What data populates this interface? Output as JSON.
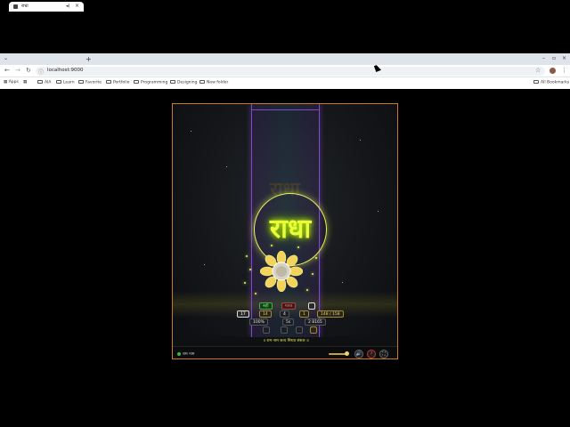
{
  "browser": {
    "tab_title": "राधा",
    "tab_close": "×",
    "new_tab": "+",
    "url": "localhost:9000",
    "back": "←",
    "forward": "→",
    "reload": "↻",
    "star": "☆",
    "menu": "⋮",
    "bookmarks": [
      "Apps",
      "AIA",
      "Learn",
      "Favorite",
      "Portfolio",
      "Programming",
      "Designing",
      "New folder"
    ],
    "all_bookmarks": "All Bookmarks"
  },
  "game": {
    "ghost_word": "राधा",
    "target_word": "राधा",
    "hud_row1": [
      "सही",
      "गलत",
      ""
    ],
    "hud_row2": [
      "17",
      "14",
      "4",
      "1",
      "148 / 158"
    ],
    "hud_row3": [
      "100%",
      "5s",
      "2 8165"
    ],
    "hud_row4": [
      "",
      "",
      "",
      ""
    ],
    "message": "॥ राम नाम सत्य मिथ्या संसार ॥",
    "status_label": "राम नाम",
    "volume_level": 0.8,
    "controls": [
      "🔊",
      "?",
      "⛶"
    ]
  }
}
